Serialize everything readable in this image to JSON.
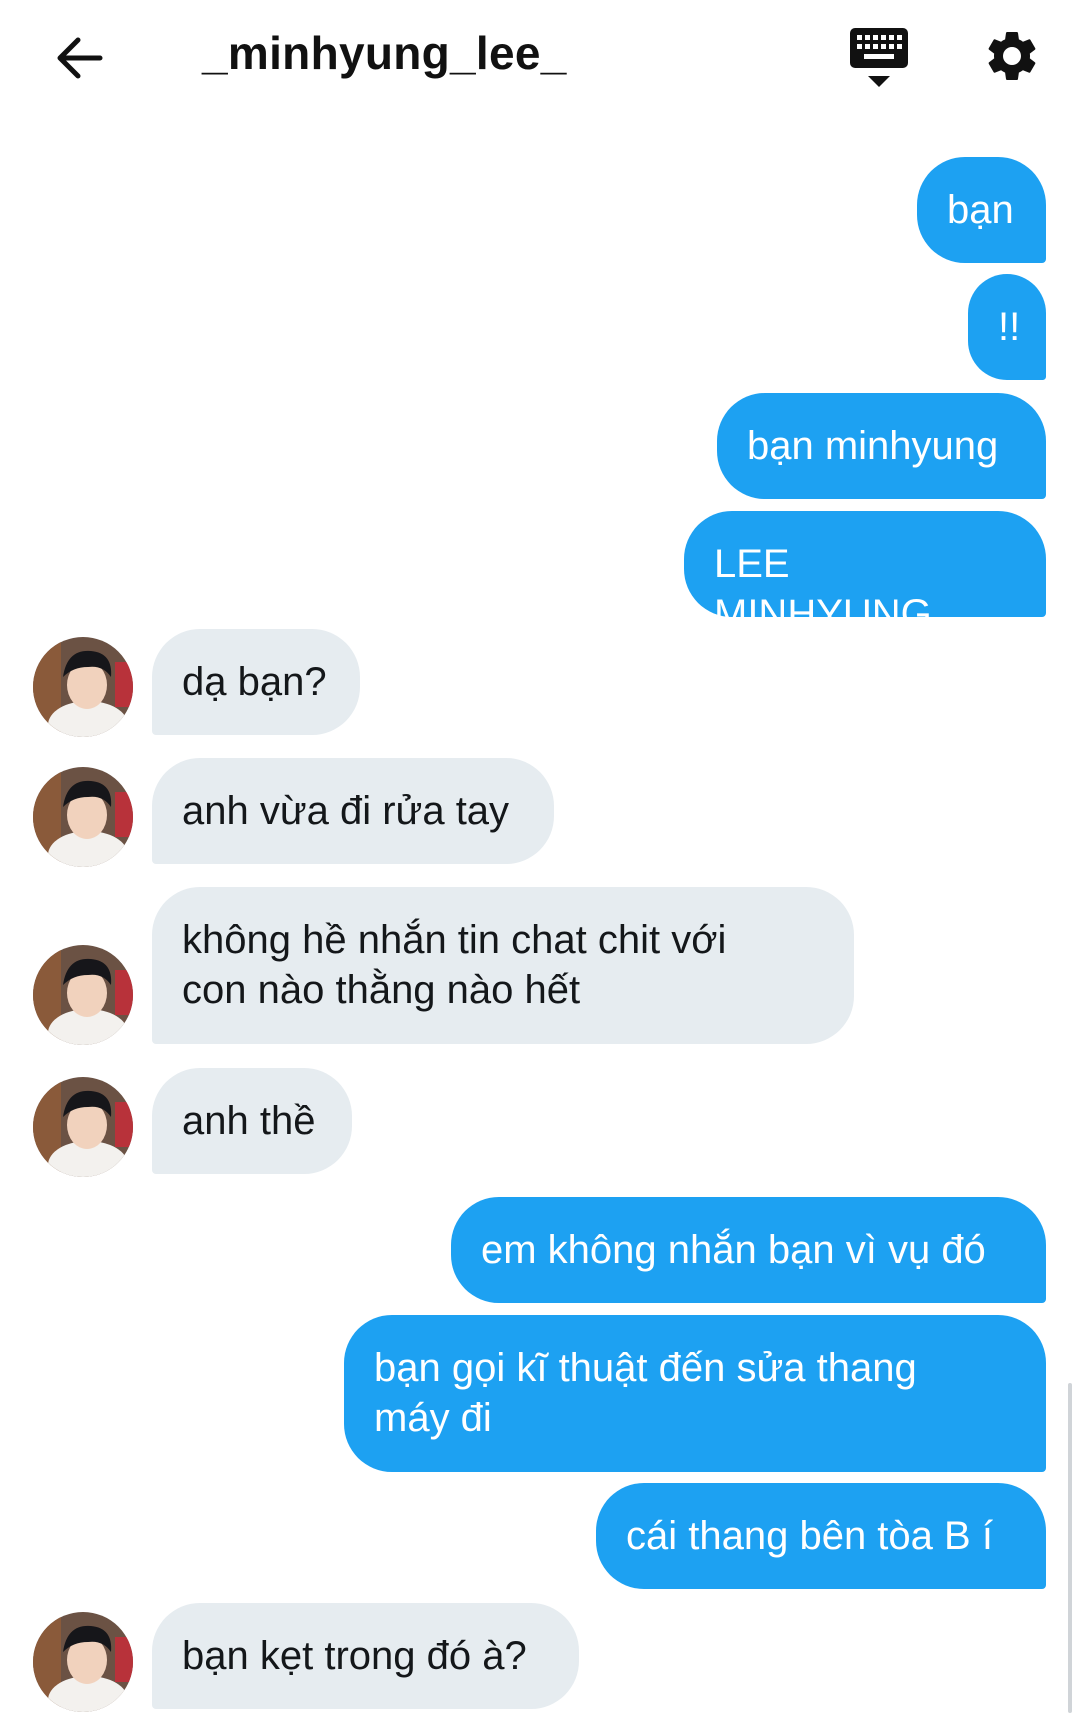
{
  "header": {
    "title": "_minhyung_lee_",
    "back_icon": "arrow-left-icon",
    "keyboard_icon": "keyboard-icon",
    "settings_icon": "gear-icon"
  },
  "colors": {
    "outgoing_bubble": "#1da1f2",
    "incoming_bubble": "#e6ecf0"
  },
  "messages": [
    {
      "dir": "out",
      "text": "bạn"
    },
    {
      "dir": "out",
      "text": "!!"
    },
    {
      "dir": "out",
      "text": "bạn minhyung"
    },
    {
      "dir": "out",
      "text": "LEE MINHYUNG"
    },
    {
      "dir": "in",
      "text": "dạ bạn?"
    },
    {
      "dir": "in",
      "text": "anh vừa đi rửa tay"
    },
    {
      "dir": "in",
      "text": "không hề nhắn tin chat chit với\ncon nào thằng nào hết"
    },
    {
      "dir": "in",
      "text": "anh thề"
    },
    {
      "dir": "out",
      "text": "em không nhắn bạn vì vụ đó"
    },
    {
      "dir": "out",
      "text": "bạn gọi kĩ thuật đến sửa thang\nmáy đi"
    },
    {
      "dir": "out",
      "text": "cái thang bên tòa B í"
    },
    {
      "dir": "in",
      "text": "bạn kẹt trong đó à?"
    }
  ]
}
